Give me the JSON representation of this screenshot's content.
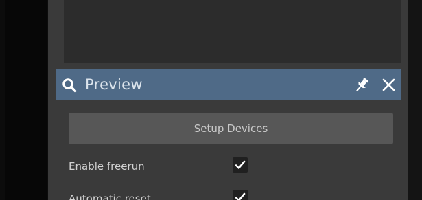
{
  "panel": {
    "title": "Preview",
    "icons": {
      "search": "search-icon",
      "pin": "pin-icon",
      "close": "close-icon"
    }
  },
  "setup_button": {
    "label": "Setup Devices"
  },
  "options": [
    {
      "label": "Enable freerun",
      "checked": true
    },
    {
      "label": "Automatic reset",
      "checked": true
    }
  ],
  "colors": {
    "header_bg": "#4f6a87",
    "panel_bg": "#3a3a3a",
    "button_bg": "#575757",
    "text": "#d2d2d2"
  }
}
